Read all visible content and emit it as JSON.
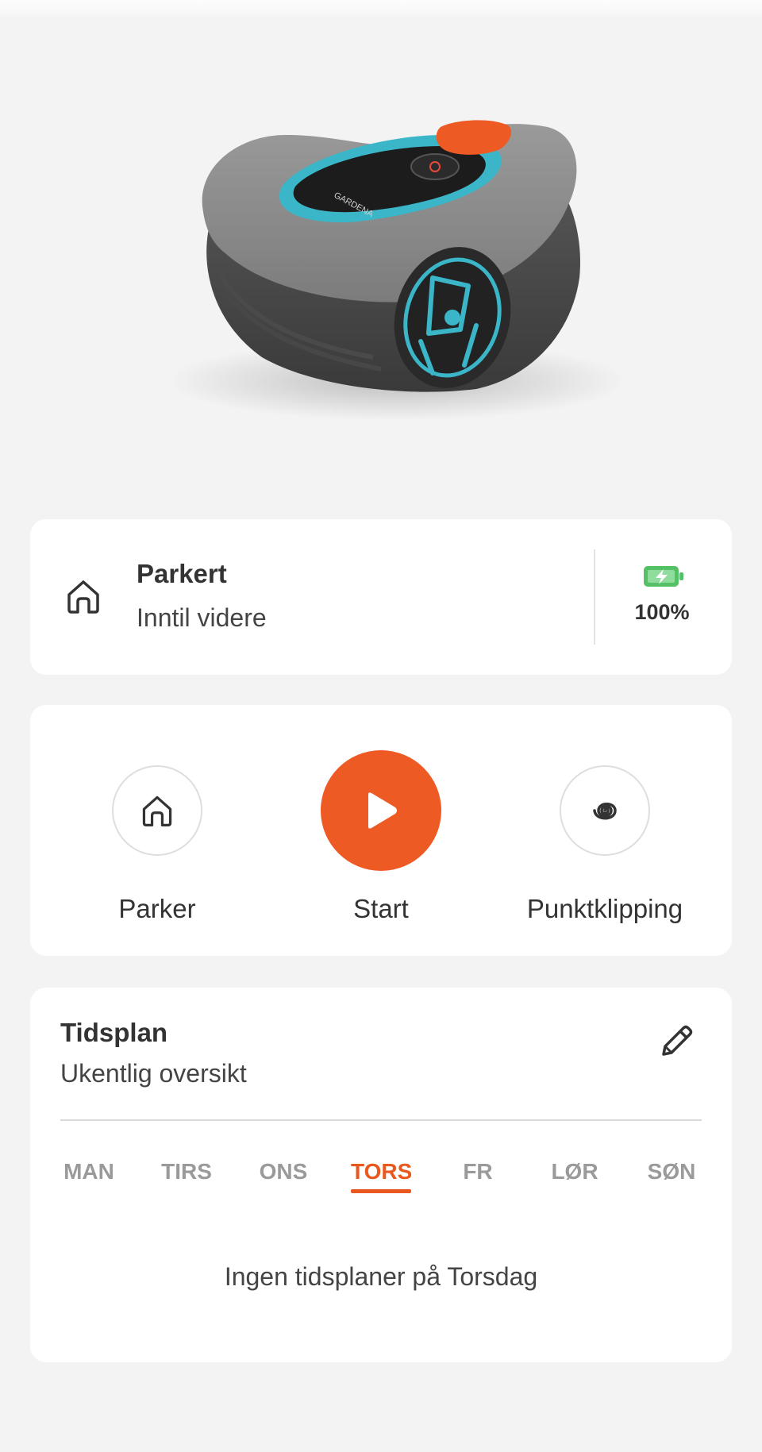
{
  "hero": {
    "image_name": "robotic-mower-image",
    "brand_text": "GARDENA"
  },
  "status": {
    "icon": "home-icon",
    "title": "Parkert",
    "subtitle": "Inntil videre",
    "battery_icon": "battery-charging-icon",
    "battery_level": "100%",
    "battery_color": "#55c167"
  },
  "actions": {
    "park_label": "Parker",
    "start_label": "Start",
    "spot_label": "Punktklipping",
    "accent": "#ee5a24"
  },
  "schedule": {
    "title": "Tidsplan",
    "subtitle": "Ukentlig oversikt",
    "edit_icon": "pencil-icon",
    "days": [
      "MAN",
      "TIRS",
      "ONS",
      "TORS",
      "FR",
      "LØR",
      "SØN"
    ],
    "selected_day": "TORS",
    "empty_message": "Ingen tidsplaner på Torsdag"
  }
}
